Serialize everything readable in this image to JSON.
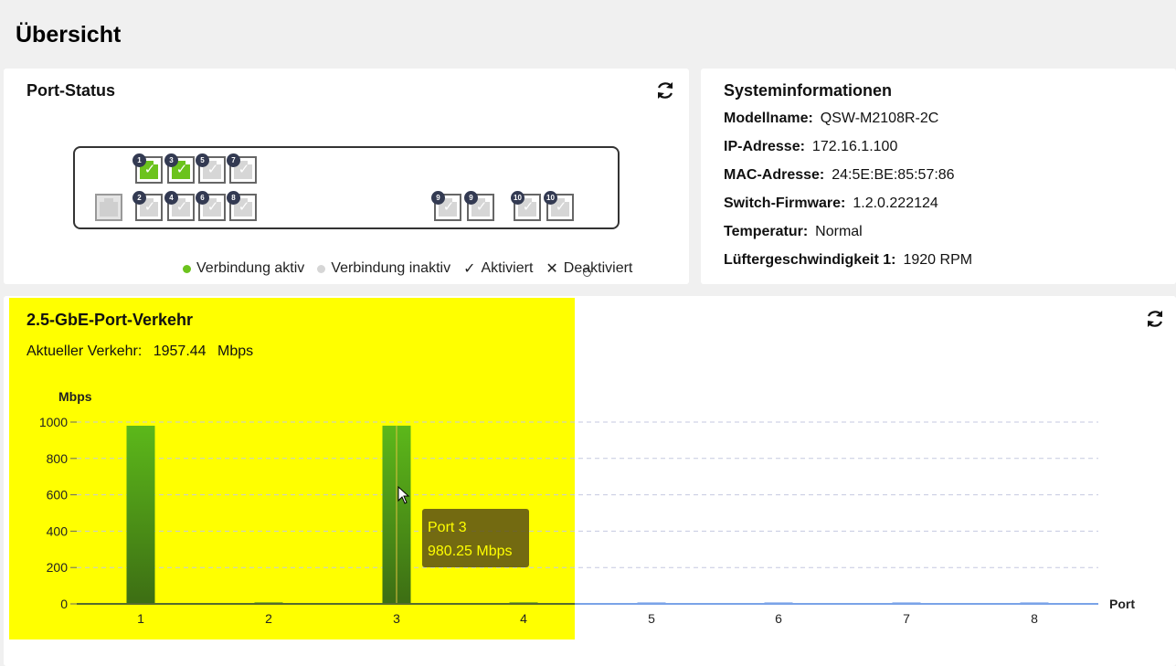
{
  "page": {
    "title": "Übersicht"
  },
  "port_status": {
    "title": "Port-Status",
    "legend": {
      "active": "Verbindung aktiv",
      "inactive": "Verbindung inaktiv",
      "enabled": "Aktiviert",
      "disabled": "Deaktiviert"
    },
    "top_ports": [
      {
        "label": "1",
        "active": true
      },
      {
        "label": "3",
        "active": true
      },
      {
        "label": "5",
        "active": false
      },
      {
        "label": "7",
        "active": false
      }
    ],
    "bottom_ports": [
      {
        "label": "2",
        "active": false
      },
      {
        "label": "4",
        "active": false
      },
      {
        "label": "6",
        "active": false
      },
      {
        "label": "8",
        "active": false
      }
    ],
    "sfp_ports": [
      {
        "label": "9"
      },
      {
        "label": "9"
      },
      {
        "label": "10"
      },
      {
        "label": "10"
      }
    ],
    "colors": {
      "active": "#6cc31d",
      "inactive": "#d6d6d6"
    }
  },
  "system_info": {
    "title": "Systeminformationen",
    "rows": [
      {
        "key": "Modellname:",
        "value": "QSW-M2108R-2C"
      },
      {
        "key": "IP-Adresse:",
        "value": "172.16.1.100"
      },
      {
        "key": "MAC-Adresse:",
        "value": "24:5E:BE:85:57:86"
      },
      {
        "key": "Switch-Firmware:",
        "value": "1.2.0.222124"
      },
      {
        "key": "Temperatur:",
        "value": "Normal"
      },
      {
        "key": "Lüftergeschwindigkeit 1:",
        "value": "1920 RPM"
      }
    ]
  },
  "traffic": {
    "title": "2.5-GbE-Port-Verkehr",
    "current_label": "Aktueller Verkehr:",
    "current_value": "1957.44",
    "current_unit": "Mbps",
    "tooltip": {
      "port": "Port  3",
      "value": "980.25  Mbps"
    }
  },
  "chart_data": {
    "type": "bar",
    "categories": [
      "1",
      "2",
      "3",
      "4",
      "5",
      "6",
      "7",
      "8"
    ],
    "values": [
      980,
      8,
      980.25,
      8,
      8,
      8,
      8,
      8
    ],
    "ylabel": "Mbps",
    "xlabel": "Port",
    "ylim": [
      0,
      1000
    ],
    "yticks": [
      0,
      200,
      400,
      600,
      800,
      1000
    ],
    "grid": true,
    "bar_colors": {
      "active_top": "#5cb81a",
      "active_bottom": "#3d6e14",
      "inactive": "#7aa3e8"
    }
  }
}
